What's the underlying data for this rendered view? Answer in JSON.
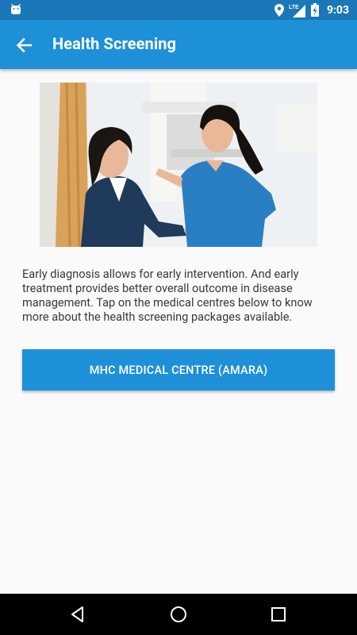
{
  "status_bar": {
    "time": "9:03",
    "network_label": "LTE",
    "icons": [
      "android-icon",
      "location-icon",
      "lte-signal-icon",
      "battery-charging-icon"
    ]
  },
  "app_bar": {
    "title": "Health Screening",
    "back_icon": "arrow-back-icon"
  },
  "hero_image": {
    "description": "Health screening staff assisting a patient at a mammography machine"
  },
  "intro_text": "Early diagnosis allows for early intervention. And early treatment provides better overall outcome in disease management. Tap on the medical centres below to know more about the health screening packages available.",
  "centres": [
    {
      "label": "MHC MEDICAL CENTRE (AMARA)"
    }
  ],
  "nav_bar": {
    "icons": [
      "back-triangle-icon",
      "home-circle-icon",
      "recents-square-icon"
    ]
  },
  "colors": {
    "status_bar": "#1a78b8",
    "app_bar": "#1e90d8",
    "button": "#1e90d8",
    "background": "#fafafa",
    "body_text": "#3a3a3a"
  }
}
